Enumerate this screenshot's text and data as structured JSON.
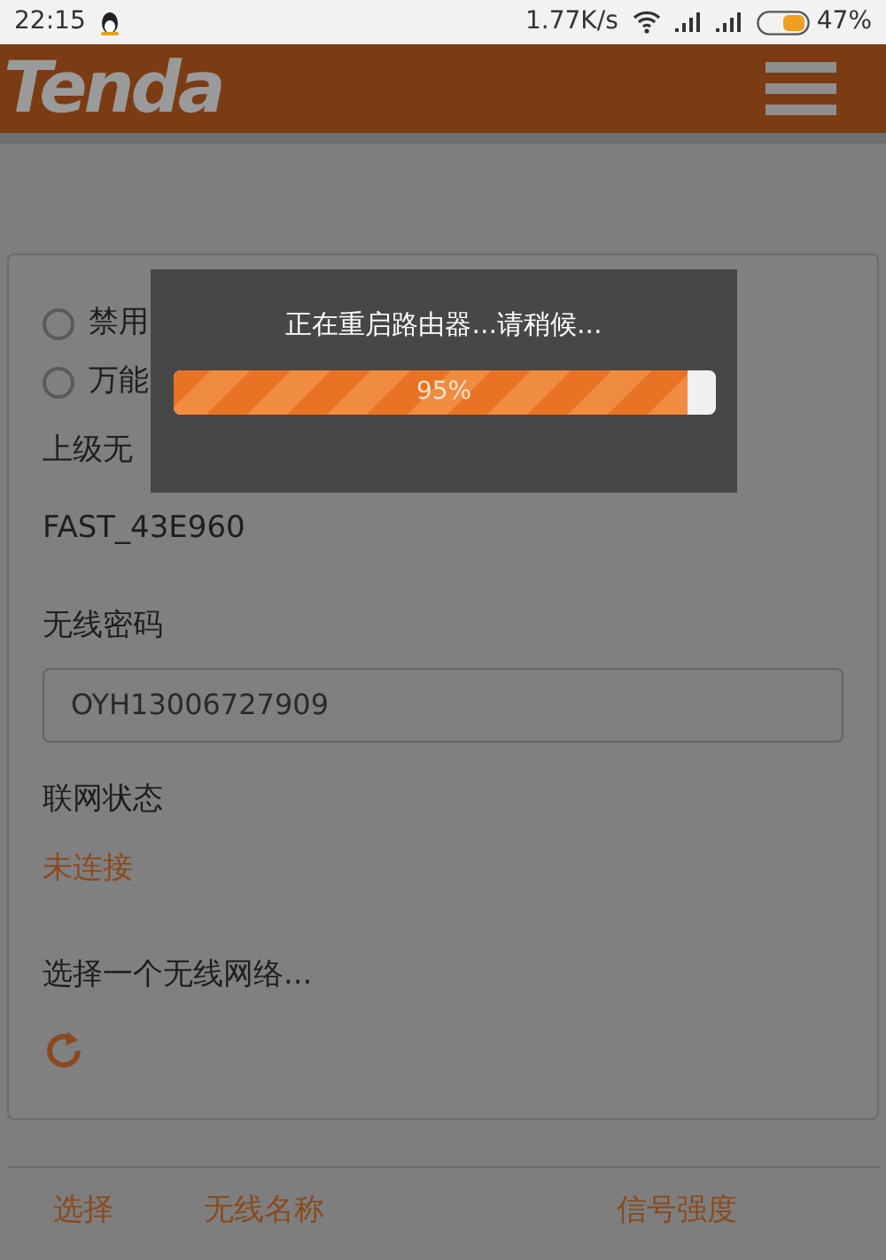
{
  "status_bar": {
    "time": "22:15",
    "speed": "1.77K/s",
    "battery": "47%"
  },
  "header": {
    "logo": "Tenda"
  },
  "modes": [
    {
      "label": "禁用",
      "selected": false
    },
    {
      "label": "万能",
      "selected": false
    }
  ],
  "upstream": {
    "label": "上级无",
    "value": "FAST_43E960"
  },
  "password": {
    "label": "无线密码",
    "value": "OYH13006727909"
  },
  "connection": {
    "label": "联网状态",
    "value": "未连接"
  },
  "network_prompt": "选择一个无线网络...",
  "dialog": {
    "message": "正在重启路由器...请稍候...",
    "level": 0.95,
    "reading": "95%"
  },
  "table": {
    "columns": [
      "选择",
      "无线名称",
      "信号强度"
    ]
  }
}
